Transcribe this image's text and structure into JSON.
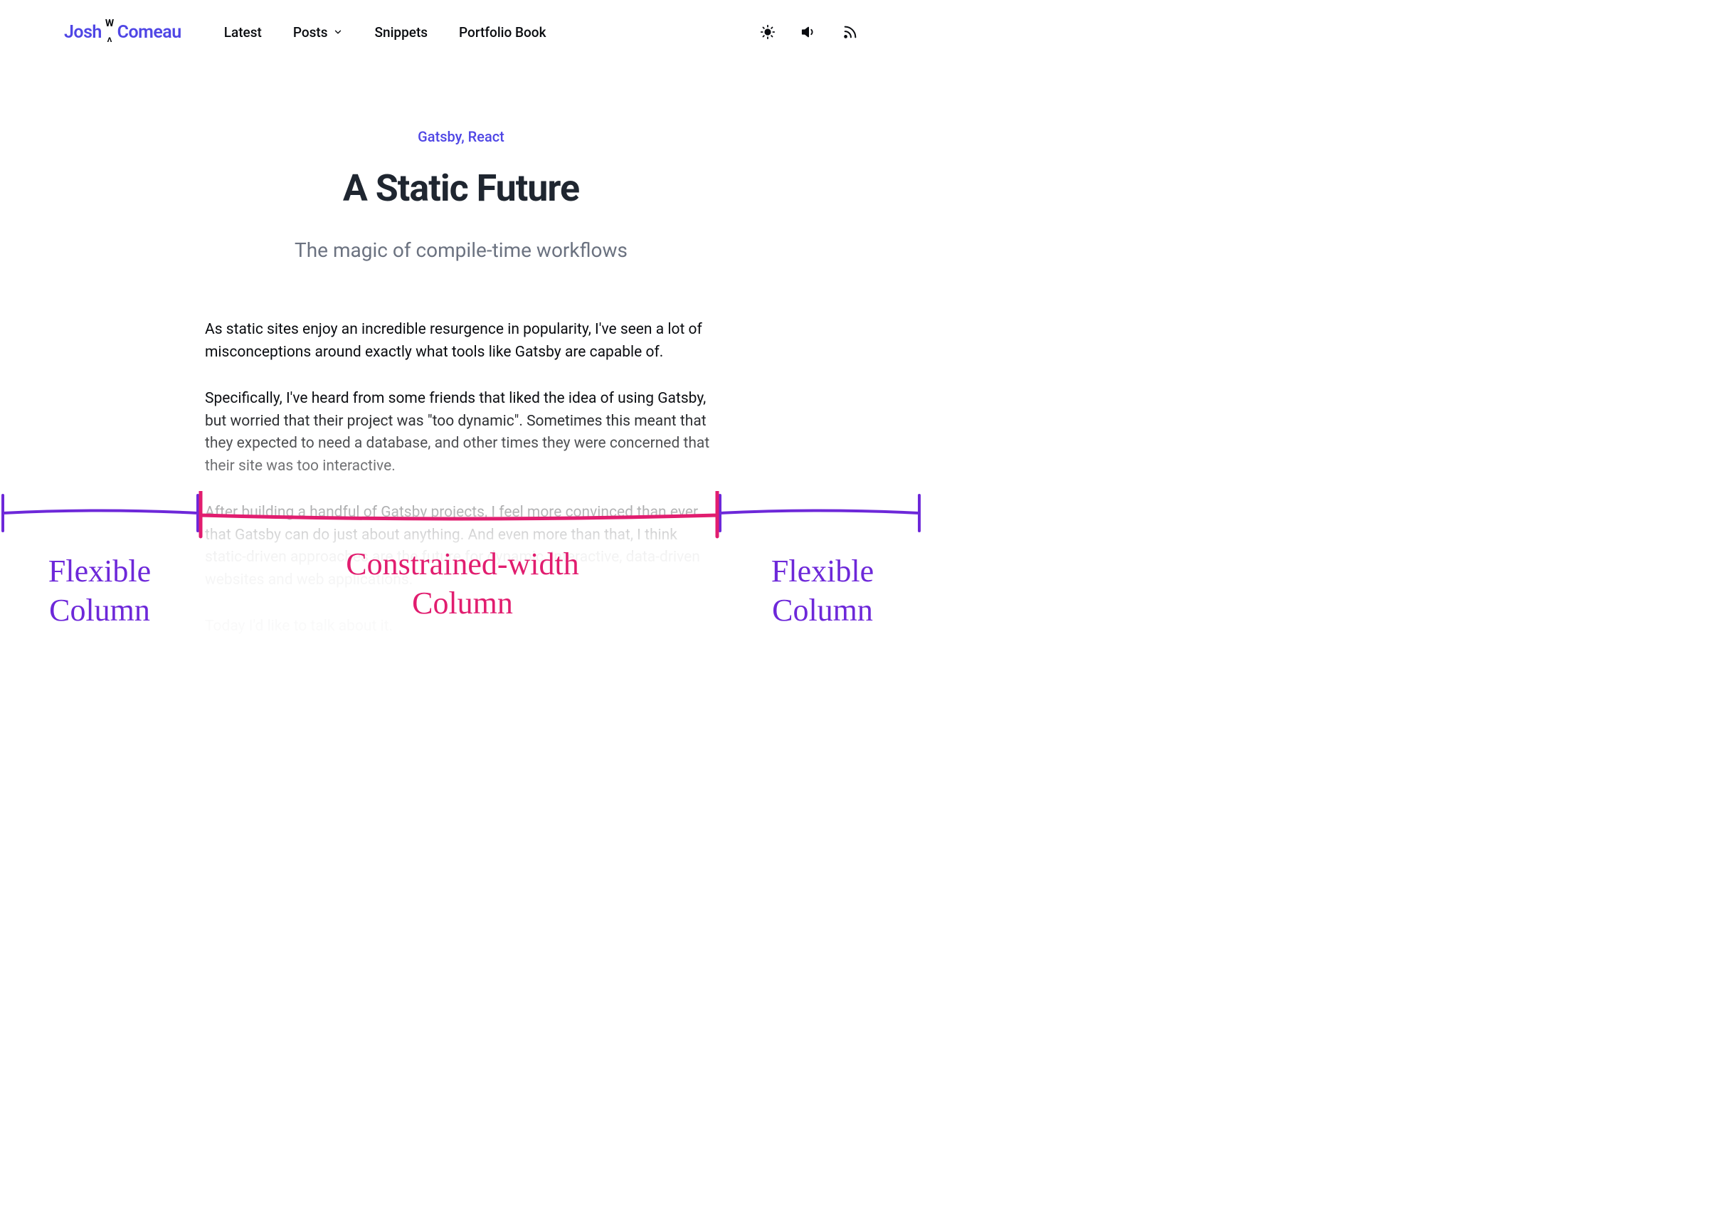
{
  "logo": {
    "first": "Josh",
    "glyph_top": "W",
    "glyph_bottom": "ʌ",
    "last": "Comeau"
  },
  "nav": {
    "latest": "Latest",
    "posts": "Posts",
    "snippets": "Snippets",
    "portfolio": "Portfolio Book"
  },
  "article": {
    "categories": "Gatsby, React",
    "title": "A Static Future",
    "subtitle": "The magic of compile-time workflows",
    "p1": "As static sites enjoy an incredible resurgence in popularity, I've seen a lot of misconceptions around exactly what tools like Gatsby are capable of.",
    "p2": "Specifically, I've heard from some friends that liked the idea of using Gatsby, but worried that their project was \"too dynamic\". Sometimes this meant that they expected to need a database, and other times they were concerned that their site was too interactive.",
    "p3": "After building a handful of Gatsby projects, I feel more convinced than ever that Gatsby can do just about anything. And even more than that, I think static-driven approaches are the future for dynamic, interactive, data-driven websites and web applications.",
    "p4": "Today I'd like to talk about it."
  },
  "annotations": {
    "left": "Flexible Column",
    "mid_line1": "Constrained-width",
    "mid_line2": "Column",
    "right": "Flexible Column"
  }
}
